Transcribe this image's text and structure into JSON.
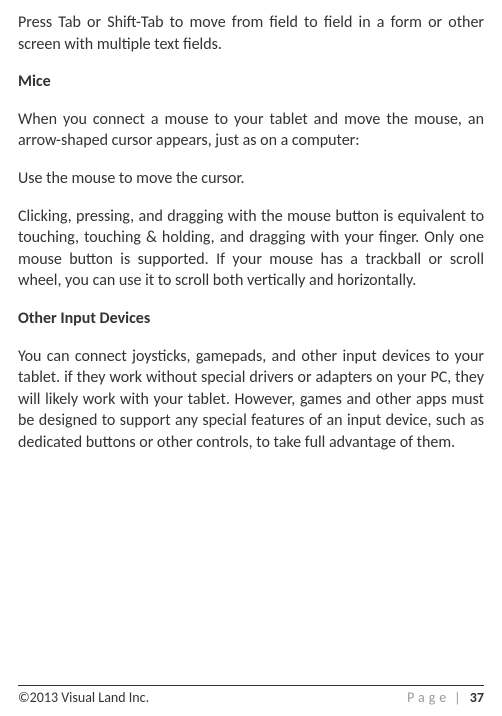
{
  "body": {
    "p1": "Press Tab or Shift-Tab to move from field to field in a form or other screen with multiple text fields.",
    "h1": "Mice",
    "p2": "When you connect a mouse to your tablet and move the mouse, an arrow-shaped cursor appears, just as on a computer:",
    "p3": "Use the mouse to move the cursor.",
    "p4": "Clicking, pressing, and dragging with the mouse button is equivalent to touching, touching & holding, and dragging with your finger. Only one mouse button is supported. If your mouse has a trackball or scroll wheel, you can use it to scroll both vertically and horizontally.",
    "h2": "Other Input Devices",
    "p5": "You can connect joysticks, gamepads, and other input devices to your tablet. if they work without special drivers or adapters on your PC, they will likely work with your tablet. However, games and other apps must be designed to support any special features of an input device, such as dedicated buttons or other controls, to take full advantage of them."
  },
  "footer": {
    "copyright": "©2013 Visual Land Inc.",
    "page_label": "Page",
    "page_sep": "|",
    "page_number": "37"
  }
}
